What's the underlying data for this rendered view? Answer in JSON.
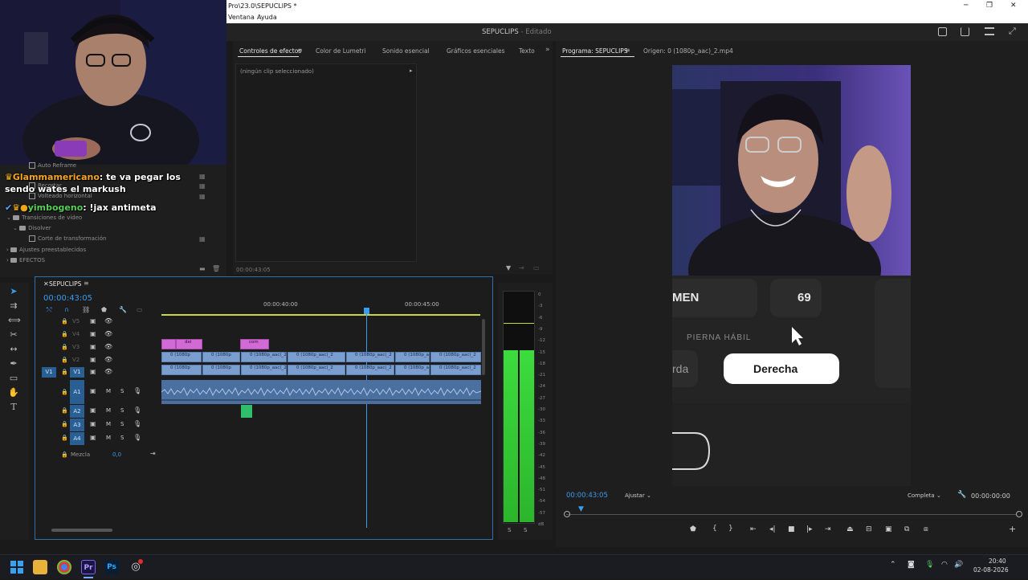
{
  "titlebar": {
    "title": "Pro\\23.0\\SEPUCLIPS *"
  },
  "menu": {
    "items": [
      "Ventana",
      "Ayuda"
    ]
  },
  "workspace": {
    "project": "SEPUCLIPS",
    "status": "- Editado"
  },
  "chat": [
    {
      "user": "Glammamericano",
      "message": "te va pegar los sendo wates el markush",
      "user_color": "#f5a623"
    },
    {
      "user": "yimbogeno",
      "message": "!jax antimeta",
      "user_color": "#58d058"
    }
  ],
  "effects_panel": {
    "items": [
      "Auto Reframe",
      "Recortar",
      "Volteado horizontal",
      "Transiciones de vídeo",
      "Disolver",
      "Corte de transformación",
      "Ajustes preestablecidos",
      "EFECTOS"
    ]
  },
  "effect_controls": {
    "tabs": [
      "Controles de efectos",
      "Color de Lumetri",
      "Sonido esencial",
      "Gráficos esenciales",
      "Texto"
    ],
    "no_clip": "(ningún clip seleccionado)",
    "timecode": "00:00:43:05"
  },
  "program": {
    "tab": "Programa: SEPUCLIPS",
    "source": "Origen: 0 (1080p_aac)_2.mp4",
    "timecode": "00:00:43:05",
    "fit": "Ajustar",
    "quality": "Completa",
    "duration": "00:00:00:00",
    "overlay": {
      "men": "MEN",
      "number": "69",
      "pierna": "PIERNA HÁBIL",
      "izq": "rda",
      "der": "Derecha"
    }
  },
  "timeline": {
    "sequence": "SEPUCLIPS",
    "timecode": "00:00:43:05",
    "ruler": [
      "00:00:40:00",
      "00:00:45:00"
    ],
    "video_tracks": [
      "V5",
      "V4",
      "V3",
      "V2",
      "V1"
    ],
    "audio_tracks": [
      "A1",
      "A2",
      "A3",
      "A4"
    ],
    "source_patch": "V1",
    "mix_label": "Mezcla",
    "mix_value": "0,0",
    "clip_label": "0 (1080p_aac)_2",
    "clip_short": "0 (1080p",
    "pink_labels": [
      "dei",
      "com"
    ],
    "audio_mute": "M",
    "audio_solo": "S"
  },
  "meters": {
    "scale": [
      "0",
      "-3",
      "-6",
      "-9",
      "-12",
      "-15",
      "-18",
      "-21",
      "-24",
      "-27",
      "-30",
      "-33",
      "-36",
      "-39",
      "-42",
      "-45",
      "-48",
      "-51",
      "-54",
      "-57",
      "dB"
    ],
    "solo": [
      "S",
      "S"
    ]
  },
  "taskbar": {
    "time": "20:40",
    "date": "02-08-2026"
  },
  "colors": {
    "accent": "#2d8ceb",
    "timecode": "#3a9bf0",
    "meter": "#3ddc3d",
    "selection_border": "#2e6fb0"
  }
}
